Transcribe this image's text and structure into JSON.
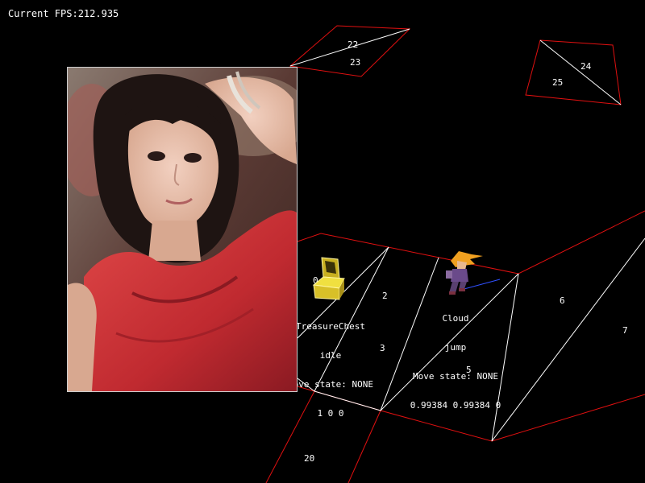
{
  "hud": {
    "fps_label": "Current FPS:",
    "fps_value": "212.935"
  },
  "triangle_labels": {
    "t0": "0",
    "t2": "2",
    "t3": "3",
    "t5": "5",
    "t6": "6",
    "t7": "7",
    "t20": "20",
    "t22": "22",
    "t23": "23",
    "t24": "24",
    "t25": "25"
  },
  "treasure_chest": {
    "name": "TreasureChest",
    "state": "idle",
    "move_state": "Move state: NONE",
    "vector": "1 0 0"
  },
  "cloud": {
    "name": "Cloud",
    "state": "jump",
    "move_state": "Move state: NONE",
    "vector": "0.99384 0.99384 0"
  },
  "colors": {
    "background": "#000000",
    "edge_red": "#e01010",
    "edge_white": "#ffffff",
    "edge_blue": "#3050ff",
    "chest_gold": "#e8d030"
  },
  "icons": {
    "photo": "portrait-photo",
    "chest": "treasure-chest-sprite",
    "cloud": "cloud-character-sprite"
  }
}
